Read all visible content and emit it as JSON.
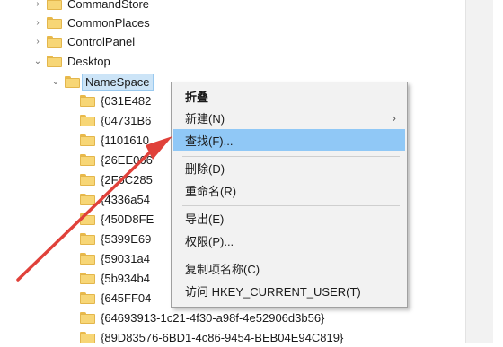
{
  "tree": {
    "items": [
      {
        "label": "CommandStore",
        "expander": "›"
      },
      {
        "label": "CommonPlaces",
        "expander": "›"
      },
      {
        "label": "ControlPanel",
        "expander": "›"
      },
      {
        "label": "Desktop",
        "expander": "⌄"
      },
      {
        "label": "NameSpace",
        "expander": "⌄"
      },
      {
        "label": "{031E482"
      },
      {
        "label": "{04731B6"
      },
      {
        "label": "{1101610"
      },
      {
        "label": "{26EE066"
      },
      {
        "label": "{2F6C285"
      },
      {
        "label": "{4336a54"
      },
      {
        "label": "{450D8FE"
      },
      {
        "label": "{5399E69"
      },
      {
        "label": "{59031a4"
      },
      {
        "label": "{5b934b4"
      },
      {
        "label": "{645FF04"
      },
      {
        "label": "{64693913-1c21-4f30-a98f-4e52906d3b56}"
      },
      {
        "label": "{89D83576-6BD1-4c86-9454-BEB04E94C819}"
      }
    ]
  },
  "context_menu": {
    "collapse": "折叠",
    "new": "新建(N)",
    "new_arrow": "›",
    "find": "查找(F)...",
    "delete": "删除(D)",
    "rename": "重命名(R)",
    "export": "导出(E)",
    "permissions": "权限(P)...",
    "copy_key_name": "复制项名称(C)",
    "goto_hkcu": "访问 HKEY_CURRENT_USER(T)"
  },
  "colors": {
    "menu_highlight": "#90c8f6",
    "annotation_arrow": "#e0413a"
  }
}
